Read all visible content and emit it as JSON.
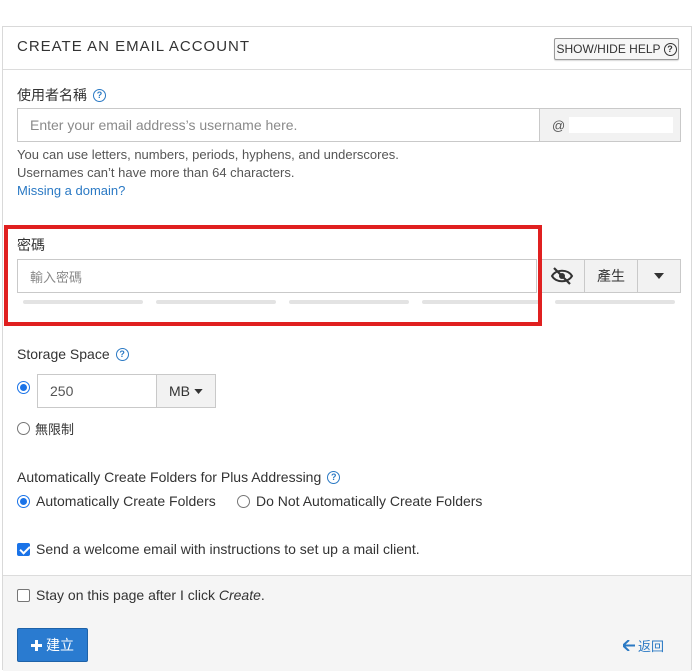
{
  "header": {
    "title": "CREATE AN EMAIL ACCOUNT",
    "help_button": "SHOW/HIDE HELP"
  },
  "username": {
    "label": "使用者名稱",
    "placeholder": "Enter your email address’s username here.",
    "domain_prefix": "@",
    "help_line1": "You can use letters, numbers, periods, hyphens, and underscores.",
    "help_line2": "Usernames can’t have more than 64 characters.",
    "missing_domain_link": "Missing a domain?"
  },
  "password": {
    "label": "密碼",
    "placeholder": "輸入密碼",
    "generate_button": "產生",
    "strength_segments": 5
  },
  "storage": {
    "label": "Storage Space",
    "value": "250",
    "unit": "MB",
    "unlimited_label": "無限制",
    "selected": "limited"
  },
  "plus_addressing": {
    "label": "Automatically Create Folders for Plus Addressing",
    "option_auto": "Automatically Create Folders",
    "option_no_auto": "Do Not Automatically Create Folders",
    "selected": "auto"
  },
  "welcome_email": {
    "label": "Send a welcome email with instructions to set up a mail client.",
    "checked": true
  },
  "stay_on_page": {
    "label_prefix": "Stay on this page after I click ",
    "label_emphasis": "Create",
    "label_suffix": ".",
    "checked": false
  },
  "actions": {
    "create_button": "建立",
    "back_link": "返回"
  },
  "colors": {
    "accent": "#2a7bd0",
    "link": "#2a79c4",
    "highlight": "#e02020"
  }
}
